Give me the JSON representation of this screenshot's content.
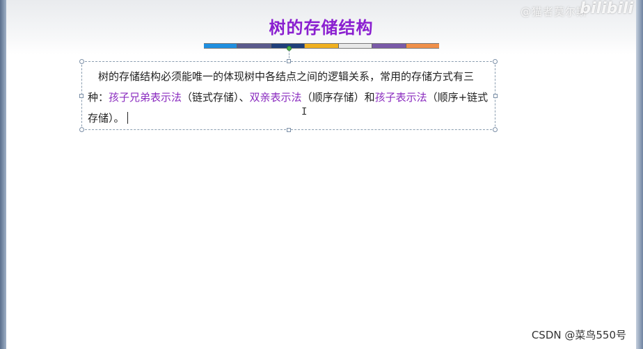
{
  "slide": {
    "title": "树的存储结构",
    "title_color": "#8a1fd0",
    "color_bar": [
      "#1f8fe0",
      "#5a5a8c",
      "#1f3f7a",
      "#f0b020",
      "#e8e8e8",
      "#7a5aa8",
      "#f0904a"
    ],
    "body": {
      "s1": "树的存储结构必须能唯一的体现树中各结点之间的逻辑关系，常用的存储方式有三种：",
      "m1": "孩子兄弟表示法",
      "s2": "（链式存储）、",
      "m2": "双亲表示法",
      "s3": "（顺序存储）和",
      "m3": "孩子表示法",
      "s4": "（顺序+链式存储）。"
    },
    "highlight_color": "#8a2bbf"
  },
  "watermarks": {
    "top_text": "@猫者莫尔斯",
    "top_logo": "bilibili",
    "bottom": "CSDN @菜鸟550号"
  }
}
